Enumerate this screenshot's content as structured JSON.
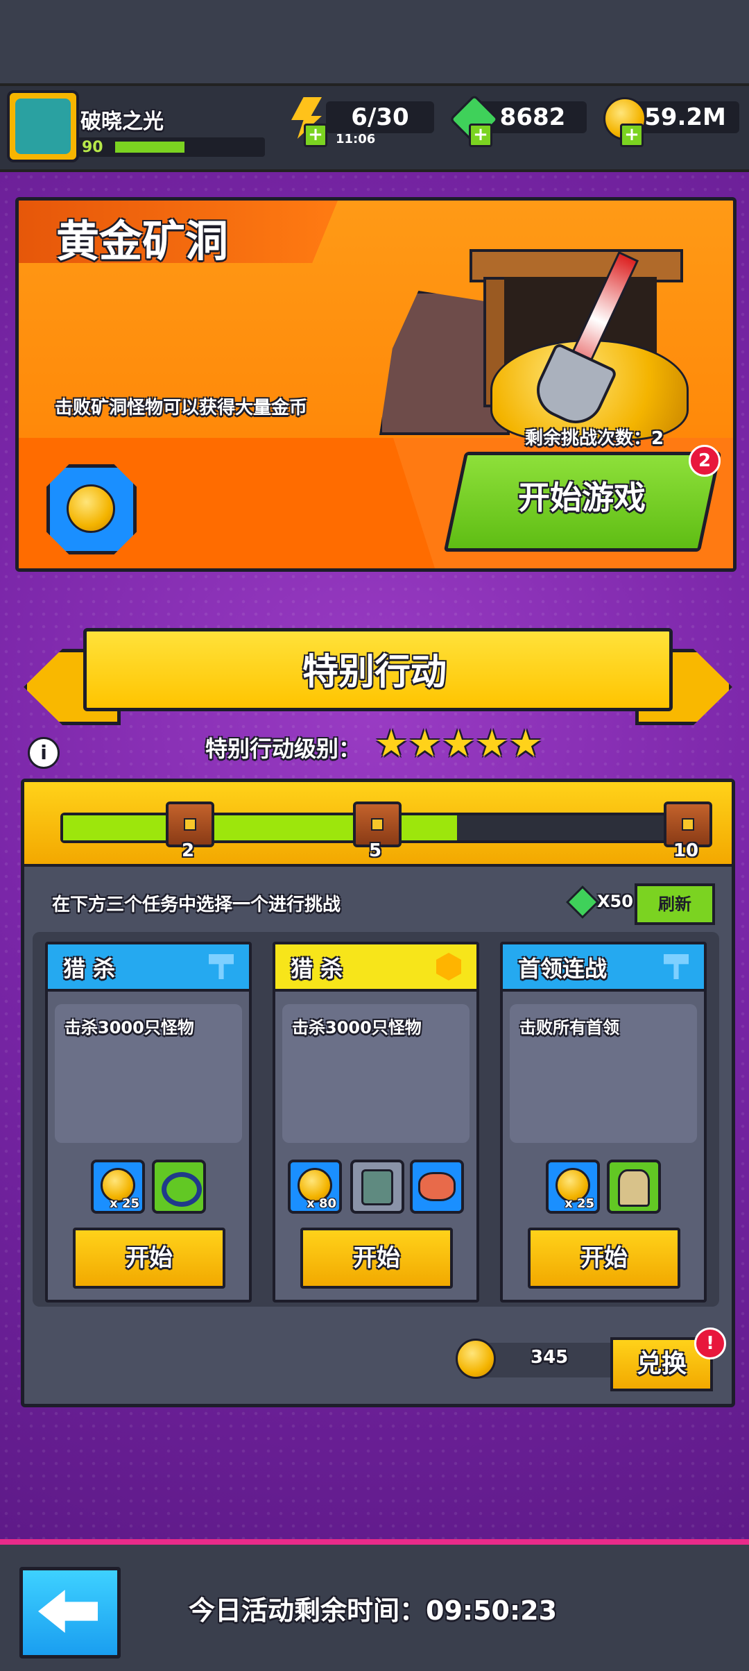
{
  "header": {
    "player_name": "破晓之光",
    "player_level": "90",
    "level_progress": 0.5,
    "energy": "6/30",
    "energy_timer": "11:06",
    "gems": "8682",
    "gold": "59.2M"
  },
  "gold_mine": {
    "title": "黄金矿洞",
    "description": "击败矿洞怪物可以获得大量金币",
    "remaining_label": "剩余挑战次数：2",
    "start_label": "开始游戏",
    "badge": "2"
  },
  "special": {
    "banner": "特别行动",
    "level_label": "特别行动级别：",
    "stars": 5,
    "progress": {
      "milestones": [
        "2",
        "5",
        "10"
      ],
      "fill_fraction": 0.62
    },
    "instruction": "在下方三个任务中选择一个进行挑战",
    "refresh_cost": "X50",
    "refresh_label": "刷新",
    "cards": [
      {
        "title": "猎 杀",
        "desc": "击杀3000只怪物",
        "coin_count": "x 25",
        "start": "开始",
        "head_color": "#25a9f0"
      },
      {
        "title": "猎 杀",
        "desc": "击杀3000只怪物",
        "coin_count": "x 80",
        "start": "开始",
        "head_color": "#f7e51a"
      },
      {
        "title": "首领连战",
        "desc": "击败所有首领",
        "coin_count": "x 25",
        "start": "开始",
        "head_color": "#25a9f0"
      }
    ],
    "coin_balance": "345",
    "exchange_label": "兑换",
    "exchange_alert": "!"
  },
  "footer": {
    "time_label": "今日活动剩余时间：09:50:23"
  },
  "colors": {
    "accent_orange": "#ff8a0a",
    "accent_green": "#7bd321",
    "accent_yellow": "#ffd21a",
    "bg_purple": "#7a26a8"
  }
}
